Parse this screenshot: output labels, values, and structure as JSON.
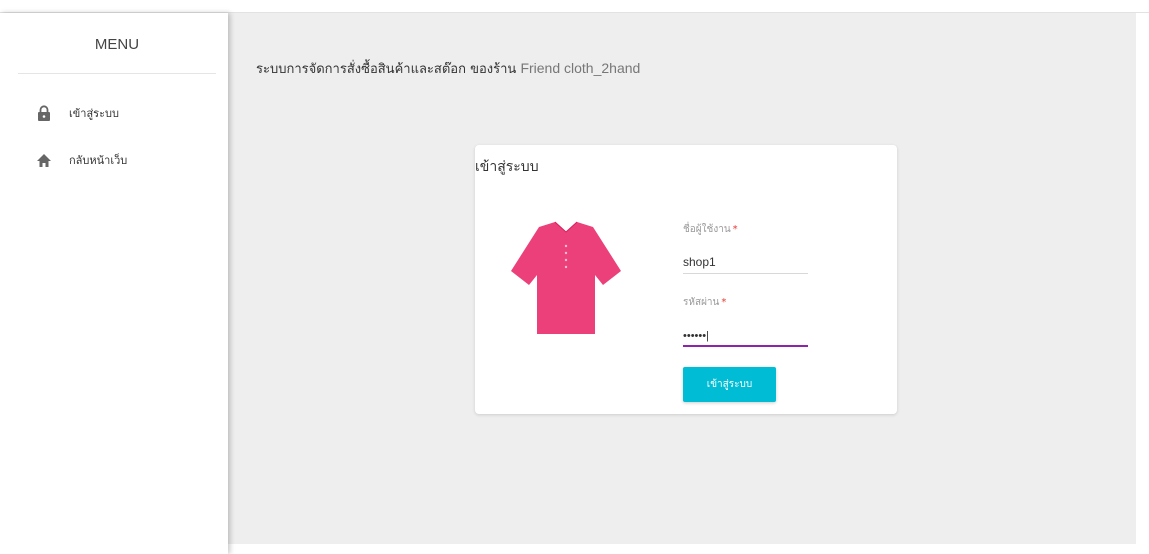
{
  "sidebar": {
    "menu_title": "MENU",
    "items": [
      {
        "label": "เข้าสู่ระบบ",
        "icon": "lock-icon"
      },
      {
        "label": "กลับหน้าเว็บ",
        "icon": "home-icon"
      }
    ]
  },
  "header": {
    "title": "ระบบการจัดการสั่งซื้อสินค้าและสต๊อก ของร้าน",
    "shop_name": "Friend cloth_2hand"
  },
  "login_card": {
    "title": "เข้าสู่ระบบ",
    "illustration": "shirt-icon",
    "username_label": "ชื่อผู้ใช้งาน",
    "username_value": "shop1",
    "password_label": "รหัสผ่าน",
    "password_value": "••••••|",
    "required_mark": "*",
    "submit_label": "เข้าสู่ระบบ"
  },
  "colors": {
    "accent_button": "#00bcd4",
    "active_underline": "#8e24aa",
    "shirt": "#ec407a",
    "required": "#e53935"
  }
}
